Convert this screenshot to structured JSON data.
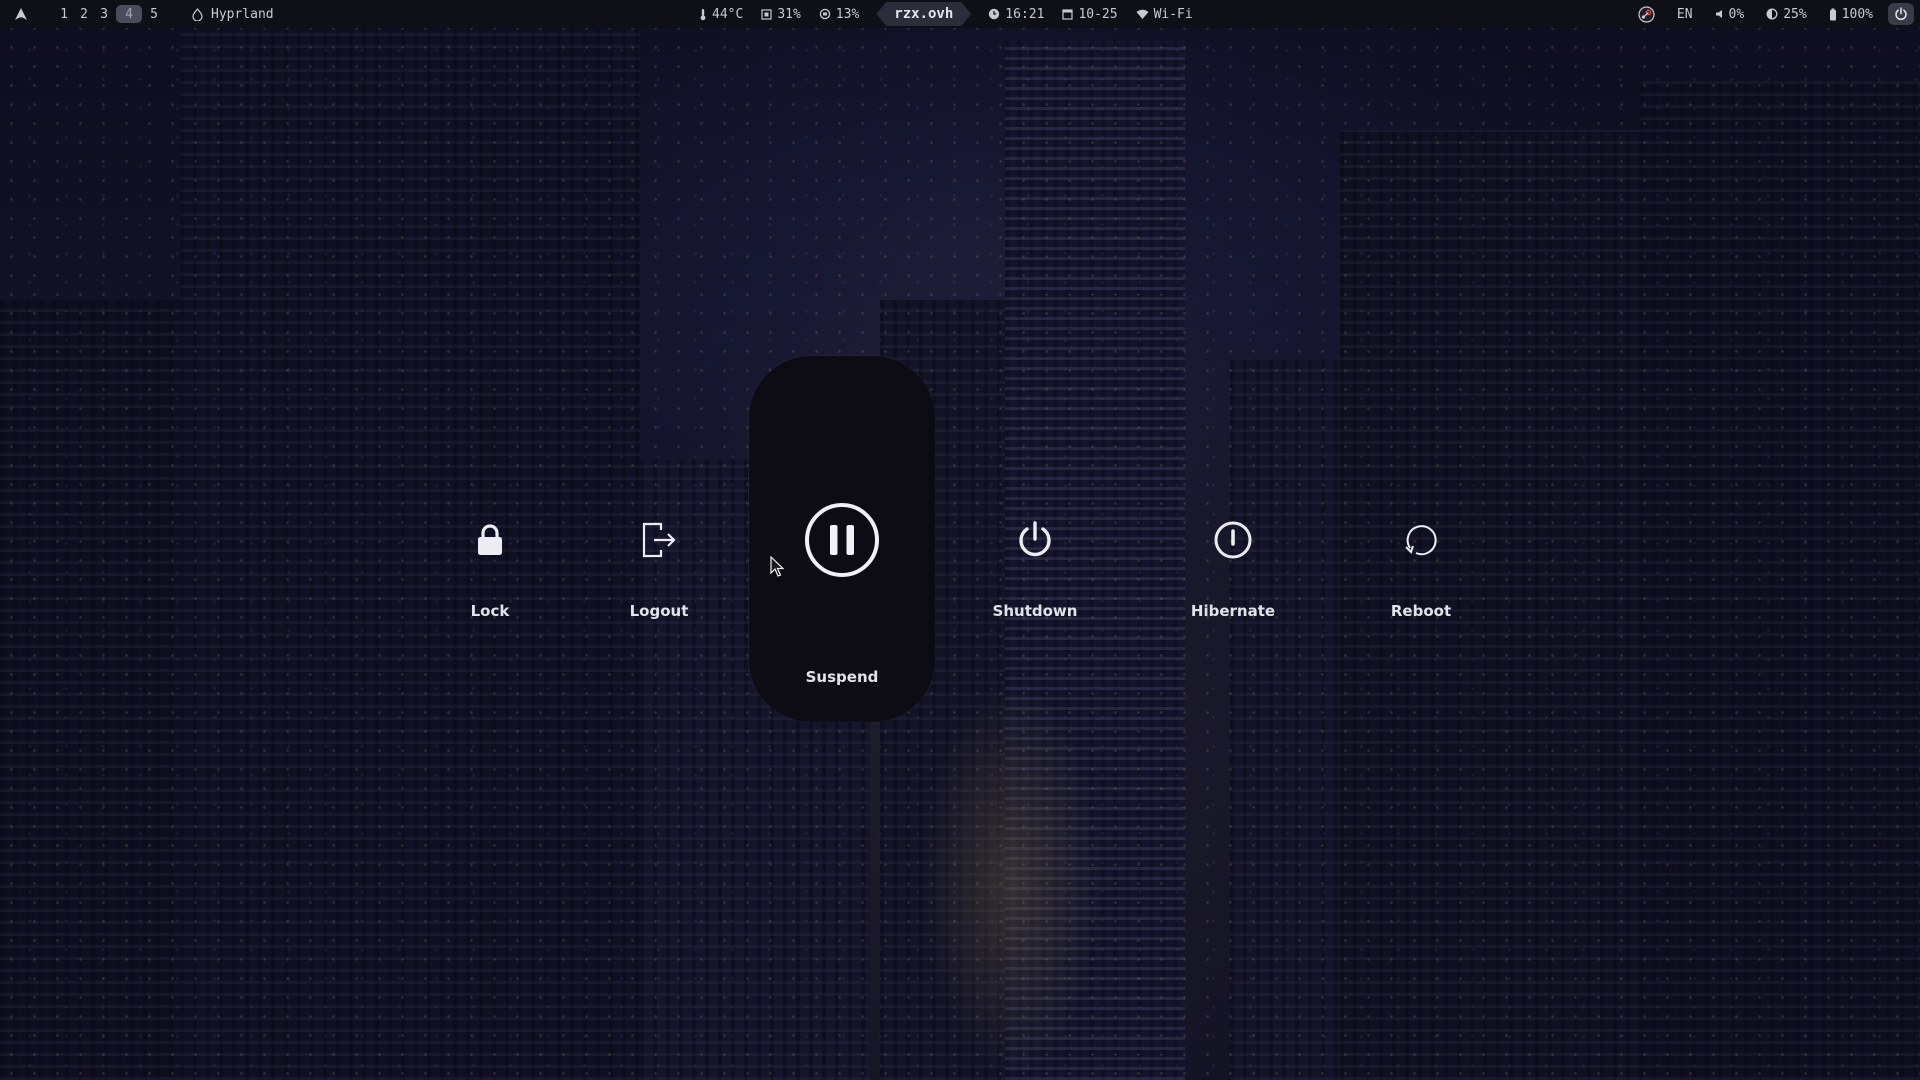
{
  "topbar": {
    "workspaces": [
      "1",
      "2",
      "3",
      "4",
      "5"
    ],
    "active_workspace": "4",
    "window_title": "Hyprland",
    "temperature": "44°C",
    "cpu": "31%",
    "memory": "13%",
    "hostname": "rzx.ovh",
    "time": "16:21",
    "date": "10-25",
    "network": "Wi-Fi",
    "keyboard_layout": "EN",
    "volume": "0%",
    "brightness": "25%",
    "battery": "100%",
    "icons": {
      "logo": "arch-logo-icon",
      "window": "flame-icon",
      "temperature": "thermometer-icon",
      "cpu": "cpu-icon",
      "memory": "memory-icon",
      "time": "clock-icon",
      "date": "calendar-icon",
      "network": "wifi-icon",
      "tray": "steam-icon",
      "volume": "speaker-icon",
      "brightness": "brightness-icon",
      "battery": "battery-icon",
      "power": "power-icon"
    }
  },
  "power_menu": {
    "selected": "Suspend",
    "items": [
      {
        "label": "Lock",
        "icon": "lock-icon"
      },
      {
        "label": "Logout",
        "icon": "logout-icon"
      },
      {
        "label": "Suspend",
        "icon": "pause-icon"
      },
      {
        "label": "Shutdown",
        "icon": "power-icon"
      },
      {
        "label": "Hibernate",
        "icon": "hibernate-icon"
      },
      {
        "label": "Reboot",
        "icon": "reboot-icon"
      }
    ]
  },
  "colors": {
    "bar_bg": "#0f0f18",
    "bar_text": "#c9c9d2",
    "active_workspace_bg": "#4b4b5c",
    "selected_tile_bg": "#0d0b14",
    "label_text": "#e2e2ea"
  }
}
